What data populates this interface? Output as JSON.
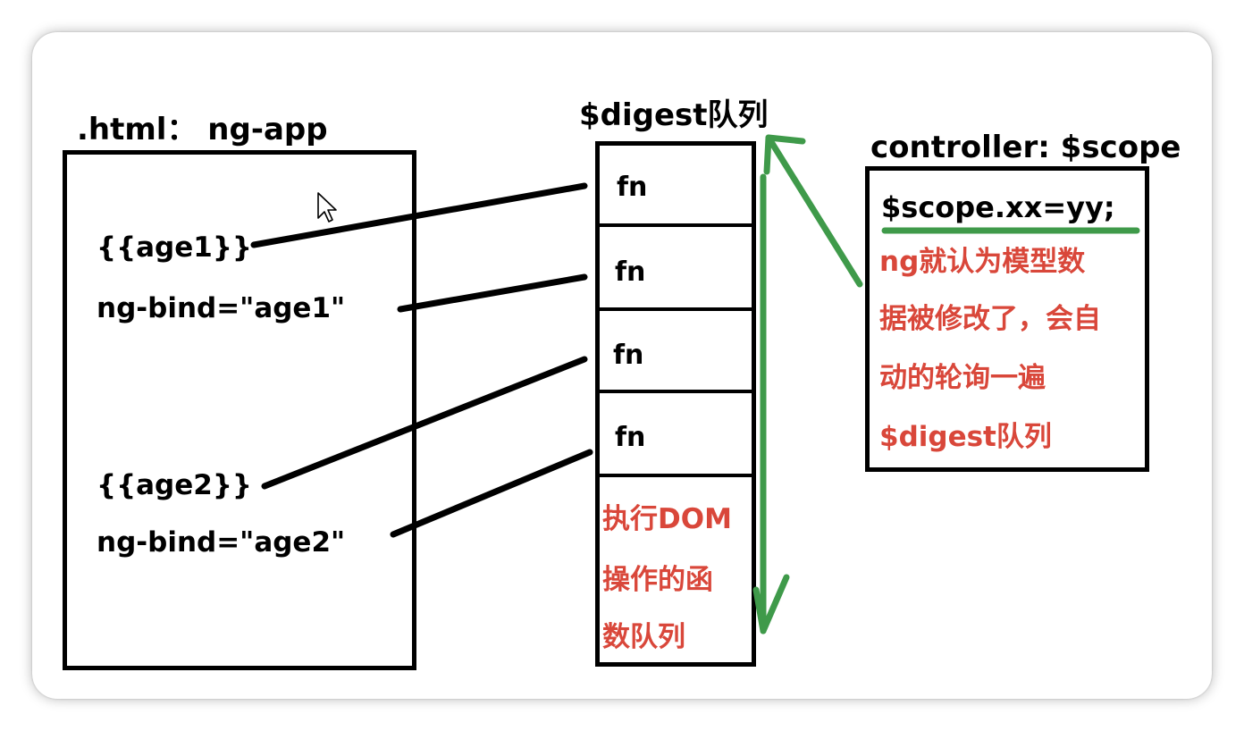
{
  "html_panel": {
    "title": ".html： ng-app",
    "bindings": [
      "{{age1}}",
      "ng-bind=\"age1\"",
      "{{age2}}",
      "ng-bind=\"age2\""
    ]
  },
  "digest_queue": {
    "title": "$digest队列",
    "cells": [
      "fn",
      "fn",
      "fn",
      "fn"
    ],
    "note_lines": [
      "执行DOM",
      "操作的函",
      "数队列"
    ]
  },
  "controller_panel": {
    "title": "controller: $scope",
    "code": "$scope.xx=yy;",
    "note_lines": [
      "ng就认为模型数",
      "据被修改了，会自",
      "动的轮询一遍",
      "$digest队列"
    ]
  },
  "colors": {
    "text": "#000000",
    "annotation": "#d9473a",
    "arrow": "#3f9a4a",
    "border": "#000000"
  },
  "icons": {
    "cursor": "mouse-pointer-icon"
  }
}
